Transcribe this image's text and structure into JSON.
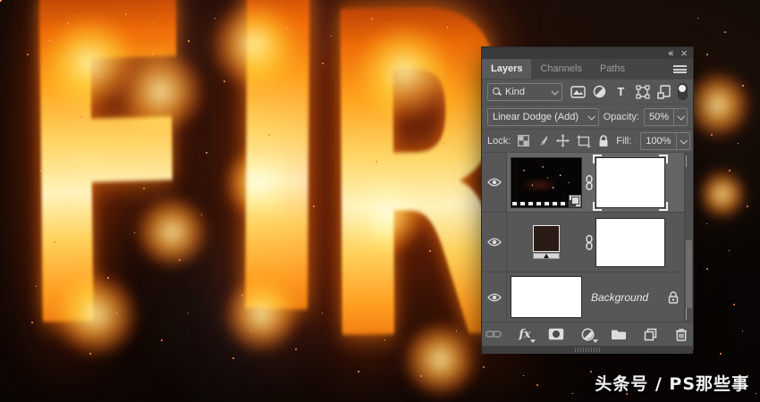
{
  "colors": {
    "panel_bg": "#565656",
    "titlebar_bg": "#3a3a3a",
    "tabbar_bg": "#454545",
    "row_selected": "#656565",
    "row_bg": "#575757",
    "text": "#e2e2e2",
    "text_dim": "#9c9c9c",
    "fire_accent": "#ff9e21",
    "levels_swatch": "#2b1b17"
  },
  "fire_text": {
    "letters": [
      "F",
      "I",
      "R"
    ]
  },
  "watermark": {
    "text": "头条号 / PS那些事"
  },
  "panel": {
    "window": {
      "collapse_icon": "«",
      "close_icon": "×"
    },
    "tabs": [
      {
        "label": "Layers",
        "active": true
      },
      {
        "label": "Channels",
        "active": false
      },
      {
        "label": "Paths",
        "active": false
      }
    ],
    "filter": {
      "kind_label": "Kind",
      "type_icon_label": "T"
    },
    "blend": {
      "mode": "Linear Dodge (Add)",
      "opacity_label": "Opacity:",
      "opacity_value": "50%"
    },
    "lock": {
      "label": "Lock:",
      "fill_label": "Fill:",
      "fill_value": "100%"
    },
    "layers": [
      {
        "kind": "smart-object-with-mask",
        "visible": true,
        "selected": true,
        "mask_selected": true
      },
      {
        "kind": "levels-adjustment-with-mask",
        "visible": true,
        "selected": false
      },
      {
        "name": "Background",
        "kind": "background",
        "visible": true,
        "locked": true
      }
    ],
    "bottom_bar": {
      "fx_label": "fx"
    }
  }
}
